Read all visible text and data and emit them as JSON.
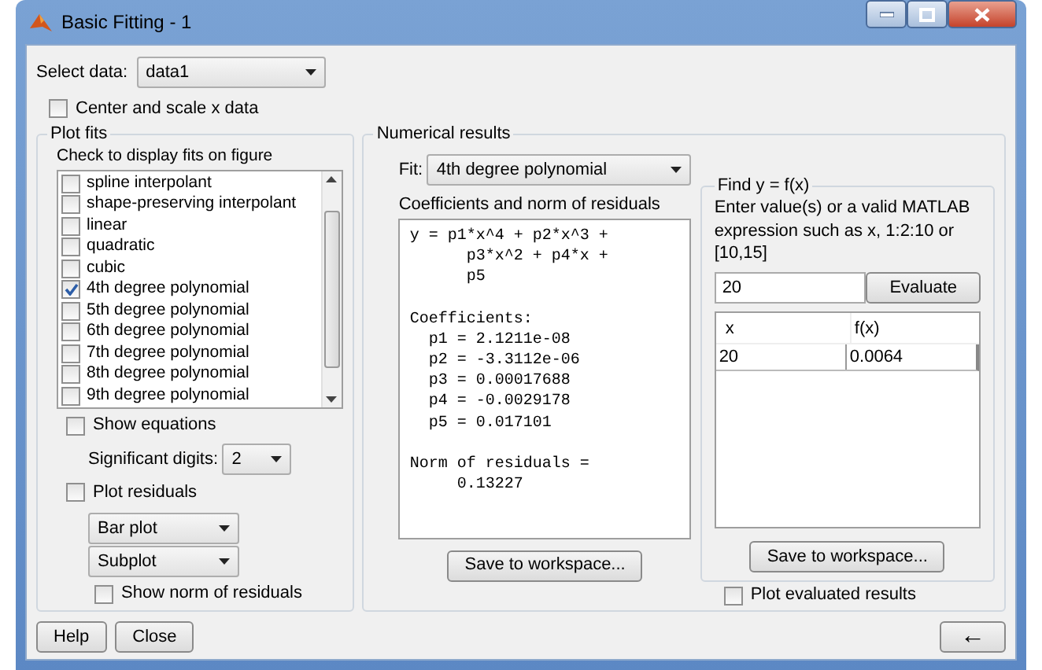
{
  "window": {
    "title": "Basic Fitting - 1"
  },
  "select_data": {
    "label": "Select data:",
    "value": "data1"
  },
  "center_scale": {
    "label": "Center and scale x data",
    "checked": false
  },
  "plot_fits": {
    "title": "Plot fits",
    "hint": "Check to display fits on figure",
    "fits": [
      {
        "label": "spline interpolant",
        "checked": false
      },
      {
        "label": "shape-preserving interpolant",
        "checked": false
      },
      {
        "label": "linear",
        "checked": false
      },
      {
        "label": "quadratic",
        "checked": false
      },
      {
        "label": "cubic",
        "checked": false
      },
      {
        "label": "4th degree polynomial",
        "checked": true
      },
      {
        "label": "5th degree polynomial",
        "checked": false
      },
      {
        "label": "6th degree polynomial",
        "checked": false
      },
      {
        "label": "7th degree polynomial",
        "checked": false
      },
      {
        "label": "8th degree polynomial",
        "checked": false
      },
      {
        "label": "9th degree polynomial",
        "checked": false
      }
    ],
    "show_equations": {
      "label": "Show equations",
      "checked": false
    },
    "significant_digits": {
      "label": "Significant digits:",
      "value": "2"
    },
    "plot_residuals": {
      "label": "Plot residuals",
      "checked": false
    },
    "residual_plot_type": {
      "value": "Bar plot"
    },
    "residual_layout": {
      "value": "Subplot"
    },
    "show_norm": {
      "label": "Show norm of residuals",
      "checked": false
    }
  },
  "numerical_results": {
    "title": "Numerical results",
    "fit_label": "Fit:",
    "fit_value": "4th degree polynomial",
    "coefficients_label": "Coefficients and norm of residuals",
    "results_text": "y = p1*x^4 + p2*x^3 +\n      p3*x^2 + p4*x +\n      p5\n\nCoefficients:\n  p1 = 2.1211e-08\n  p2 = -3.3112e-06\n  p3 = 0.00017688\n  p4 = -0.0029178\n  p5 = 0.017101\n\nNorm of residuals =\n     0.13227",
    "save_button": "Save to workspace..."
  },
  "find": {
    "title": "Find y = f(x)",
    "hint": "Enter value(s) or a valid MATLAB expression such as x, 1:2:10 or [10,15]",
    "input_value": "20",
    "evaluate_button": "Evaluate",
    "table": {
      "columns": [
        "x",
        "f(x)"
      ],
      "rows": [
        [
          "20",
          "0.0064"
        ]
      ]
    },
    "save_button": "Save to workspace...",
    "plot_evaluated": {
      "label": "Plot evaluated results",
      "checked": false
    }
  },
  "buttons": [
    "Help",
    "Close"
  ],
  "back_button": "←"
}
